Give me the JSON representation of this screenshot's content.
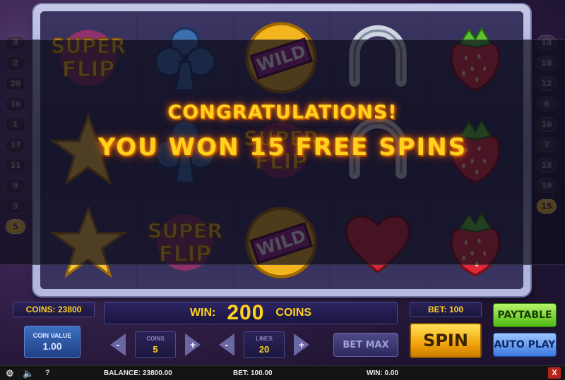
{
  "lines": {
    "left": [
      "4",
      "2",
      "20",
      "16",
      "1",
      "17",
      "11",
      "9",
      "3",
      "5"
    ],
    "right": [
      "14",
      "18",
      "12",
      "6",
      "16",
      "7",
      "13",
      "19",
      "15"
    ],
    "left_active": "5",
    "right_active": "15"
  },
  "reels": [
    [
      "superflip",
      "star",
      "star"
    ],
    [
      "club",
      "club",
      "superflip"
    ],
    [
      "wild",
      "superflip",
      "wild"
    ],
    [
      "horseshoe",
      "horseshoe",
      "heart"
    ],
    [
      "strawberry",
      "strawberry",
      "strawberry"
    ]
  ],
  "symbol_text": {
    "super": "SUPER",
    "flip": "FLIP",
    "wild": "WILD"
  },
  "overlay": {
    "line1": "CONGRATULATIONS!",
    "line2": "YOU WON 15 FREE SPINS"
  },
  "panel": {
    "coins_display": "COINS: 23800",
    "win_label": "WIN:",
    "win_amount": "200",
    "win_unit": "COINS",
    "bet_display": "BET: 100",
    "paytable": "PAYTABLE",
    "auto_play": "AUTO PLAY",
    "spin": "SPIN",
    "bet_max": "BET MAX",
    "coin_value_label": "COIN VALUE",
    "coin_value": "1.00",
    "coins_label": "COINS",
    "coins_value": "5",
    "lines_label": "LINES",
    "lines_value": "20",
    "minus": "-",
    "plus": "+"
  },
  "status": {
    "balance": "BALANCE: 23800.00",
    "bet": "BET: 100.00",
    "win": "WIN: 0.00",
    "help": "?",
    "close": "X"
  },
  "colors": {
    "gold_text": "#ffd21e",
    "paytable_green": "#4fb813",
    "autoplay_blue": "#3c78e0",
    "spin_gold": "#f2a50a"
  }
}
